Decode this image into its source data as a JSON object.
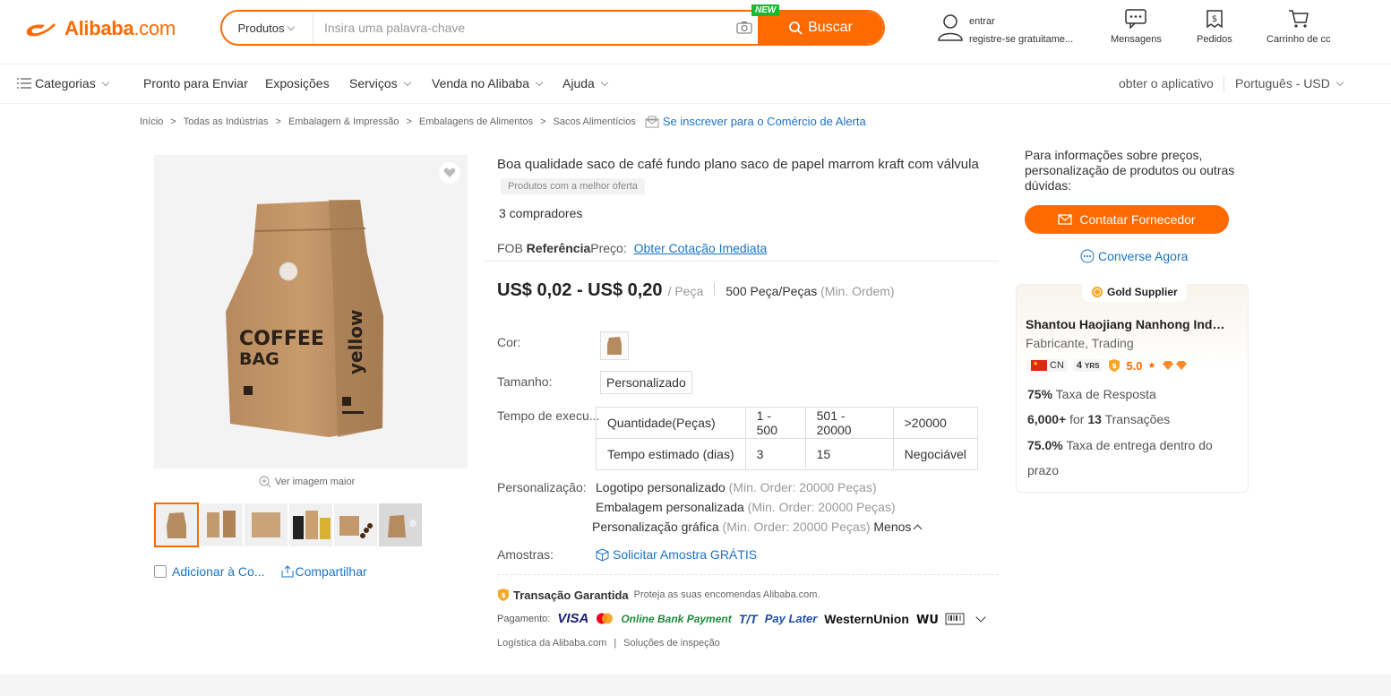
{
  "header": {
    "logo_text": "Alibaba",
    "logo_suffix": ".com",
    "search_category": "Produtos",
    "search_placeholder": "Insira uma palavra-chave",
    "new_badge": "NEW",
    "search_button": "Buscar",
    "signin": "entrar",
    "register": "registre-se gratuitame...",
    "messages": "Mensagens",
    "orders": "Pedidos",
    "cart": "Carrinho de cc"
  },
  "nav": {
    "categories": "Categorias",
    "items": [
      "Pronto para Enviar",
      "Exposições",
      "Serviços",
      "Venda no Alibaba",
      "Ajuda"
    ],
    "get_app": "obter o aplicativo",
    "language": "Português - USD"
  },
  "breadcrumb": {
    "items": [
      "Início",
      "Todas as Indústrias",
      "Embalagem & Impressão",
      "Embalagens de Alimentos",
      "Sacos Alimentícios"
    ],
    "alert": "Se inscrever para o Comércio de Alerta"
  },
  "gallery": {
    "view_larger": "Ver imagem maior",
    "add_compare": "Adicionar à Co...",
    "share": "Compartilhar",
    "bag_text_1": "COFFEE",
    "bag_text_2": "BAG",
    "bag_side": "yellow"
  },
  "product": {
    "title": "Boa qualidade saco de café fundo plano saco de papel marrom kraft com válvula",
    "badge": "Produtos com a melhor oferta",
    "buyers": "3 compradores",
    "fob_prefix": "FOB",
    "fob_ref": "Referência",
    "fob_price": "Preço:",
    "fob_link": "Obter Cotação Imediata",
    "price_range": "US$ 0,02 - US$ 0,20",
    "price_unit": "/ Peça",
    "moq": "500 Peça/Peças",
    "moq_note": "(Min. Ordem)",
    "color_label": "Cor:",
    "size_label": "Tamanho:",
    "size_value": "Personalizado",
    "lead_label": "Tempo de execu...",
    "lead_table": {
      "headers": [
        "Quantidade(Peças)",
        "1 - 500",
        "501 - 20000",
        ">20000"
      ],
      "row": [
        "Tempo estimado (dias)",
        "3",
        "15",
        "Negociável"
      ]
    },
    "custom_label": "Personalização:",
    "custom": [
      {
        "name": "Logotipo personalizado",
        "note": "(Min. Order: 20000 Peças)"
      },
      {
        "name": "Embalagem personalizada",
        "note": "(Min. Order: 20000 Peças)"
      },
      {
        "name": "Personalização gráfica",
        "note": "(Min. Order: 20000 Peças)"
      }
    ],
    "less": "Menos",
    "samples_label": "Amostras:",
    "samples_link": "Solicitar Amostra GRÁTIS",
    "ta_title": "Transação Garantida",
    "ta_desc": "Proteja as suas encomendas Alibaba.com.",
    "payment_label": "Pagamento:",
    "payments": [
      "VISA",
      "Online Bank Payment",
      "T/T",
      "Pay Later",
      "WesternUnion"
    ],
    "logistics": "Logística da Alibaba.com",
    "inspection": "Soluções de inspeção"
  },
  "supplier": {
    "info": "Para informações sobre preços, personalização de produtos ou outras dúvidas:",
    "contact": "Contatar Fornecedor",
    "chat": "Converse Agora",
    "gold": "Gold Supplier",
    "name": "Shantou Haojiang Nanhong Industrial Co., Ltd.",
    "type": "Fabricante, Trading",
    "country": "CN",
    "years": "4",
    "years_unit": "YRS",
    "rating": "5.0",
    "response_rate": "75%",
    "response_label": "Taxa de Resposta",
    "amount": "6,000+",
    "for": "for",
    "transactions": "13",
    "transactions_label": "Transações",
    "delivery_rate": "75.0%",
    "delivery_label": "Taxa de entrega dentro do prazo"
  },
  "colors": {
    "brand": "#ff6a00",
    "link": "#1a73c7"
  }
}
